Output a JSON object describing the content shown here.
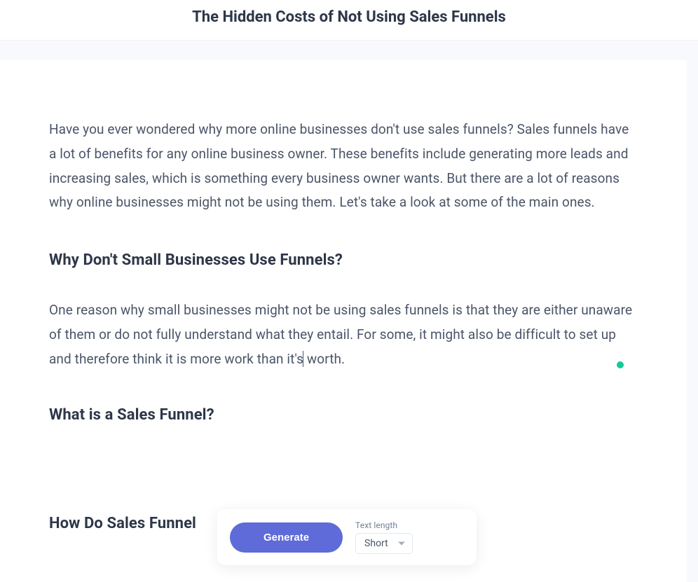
{
  "header": {
    "title": "The Hidden Costs of Not Using Sales Funnels"
  },
  "article": {
    "intro": "Have you ever wondered why more online businesses don't use sales funnels? Sales funnels have a lot of benefits for any online business owner. These benefits include generating more leads and increasing sales, which is something every business owner wants. But there are a lot of reasons why online businesses might not be using them. Let's take a look at some of the main ones.",
    "heading1": "Why Don't Small Businesses Use Funnels?",
    "para1_a": "One reason why small businesses might not be using sales funnels is that they are either unaware of them or do not fully understand what they entail. For some, it might also be difficult to set up and therefore think it is more work than it's",
    "para1_b": " worth.",
    "heading2": "What is a Sales Funnel?",
    "heading3": "How Do Sales Funnel"
  },
  "toolbar": {
    "generate_label": "Generate",
    "length_label": "Text length",
    "length_value": "Short"
  },
  "status": {
    "indicator_color": "#1ac79a"
  }
}
